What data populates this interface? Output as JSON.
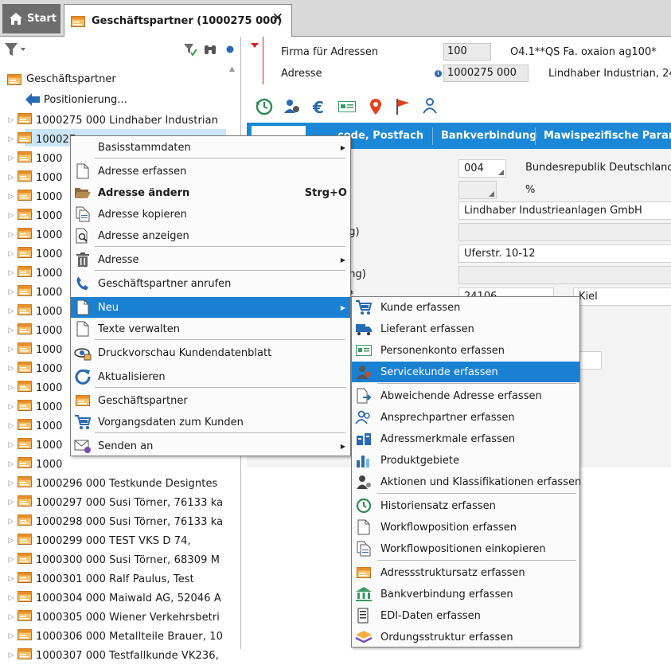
{
  "tabs": {
    "start_label": "Start",
    "active_label": "Geschäftspartner (1000275 000)"
  },
  "tree": {
    "root_label": "Geschäftspartner",
    "positioning_label": "Positionierung...",
    "rows": [
      {
        "id": "1000275",
        "sub": "000",
        "text": "Lindhaber Industrian"
      },
      {
        "id": "100027",
        "sub": "",
        "text": ""
      },
      {
        "id": "1000",
        "sub": "",
        "text": ""
      },
      {
        "id": "1000",
        "sub": "",
        "text": ""
      },
      {
        "id": "1000",
        "sub": "",
        "text": ""
      },
      {
        "id": "1000",
        "sub": "",
        "text": ""
      },
      {
        "id": "1000",
        "sub": "",
        "text": ""
      },
      {
        "id": "1000",
        "sub": "",
        "text": ""
      },
      {
        "id": "1000",
        "sub": "",
        "text": ""
      },
      {
        "id": "1000",
        "sub": "",
        "text": ""
      },
      {
        "id": "1000",
        "sub": "",
        "text": ""
      },
      {
        "id": "1000",
        "sub": "",
        "text": ""
      },
      {
        "id": "1000",
        "sub": "",
        "text": ""
      },
      {
        "id": "1000",
        "sub": "",
        "text": ""
      },
      {
        "id": "1000",
        "sub": "",
        "text": ""
      },
      {
        "id": "1000",
        "sub": "",
        "text": ""
      },
      {
        "id": "1000",
        "sub": "",
        "text": ""
      },
      {
        "id": "1000",
        "sub": "",
        "text": ""
      },
      {
        "id": "1000",
        "sub": "",
        "text": ""
      },
      {
        "id": "1000296",
        "sub": "000",
        "text": "Testkunde Designtes"
      },
      {
        "id": "1000297",
        "sub": "000",
        "text": "Susi Törner, 76133 ka"
      },
      {
        "id": "1000298",
        "sub": "000",
        "text": "Susi Törner, 76133 ka"
      },
      {
        "id": "1000299",
        "sub": "000",
        "text": "TEST VKS D 74,"
      },
      {
        "id": "1000300",
        "sub": "000",
        "text": "Susi Törner, 68309 M"
      },
      {
        "id": "1000301",
        "sub": "000",
        "text": "Ralf Paulus, Test"
      },
      {
        "id": "1000304",
        "sub": "000",
        "text": "Maiwald AG, 52046 A"
      },
      {
        "id": "1000305",
        "sub": "000",
        "text": "Wiener Verkehrsbetri"
      },
      {
        "id": "1000306",
        "sub": "000",
        "text": "Metallteile Brauer, 10"
      },
      {
        "id": "1000307",
        "sub": "000",
        "text": "Testfallkunde VK236,"
      }
    ]
  },
  "header": {
    "firma_label": "Firma für Adressen",
    "firma_value": "100",
    "firma_desc": "O4.1**QS Fa. oxaion ag100*",
    "adresse_label": "Adresse",
    "adresse_value": "1000275 000",
    "adresse_desc": "Lindhaber Industrian, 24"
  },
  "detail_tabs": {
    "tab2": "code, Postfach",
    "tab3": "Bankverbindung",
    "tab4": "Mawispezifische Parame"
  },
  "form": {
    "country_code": "004",
    "country_name": "Bundesrepublik Deutschland",
    "percent": "%",
    "name_value": "Lindhaber Industrieanlagen GmbH",
    "label_ng1": "ng)",
    "street_value": "Uferstr. 10-12",
    "label_ng2": "ung)",
    "label_star": "*",
    "zip_value": "24106",
    "city_value": "Kiel"
  },
  "context_menu": {
    "items": [
      {
        "label": "Basisstammdaten",
        "icon": "none",
        "arrow": true
      },
      {
        "label": "Adresse erfassen",
        "icon": "document-icon"
      },
      {
        "label": "Adresse ändern",
        "icon": "folder-open-icon",
        "shortcut": "Strg+O",
        "bold": true
      },
      {
        "label": "Adresse kopieren",
        "icon": "copy-icon"
      },
      {
        "label": "Adresse anzeigen",
        "icon": "magnifier-document-icon"
      },
      {
        "label": "Adresse",
        "icon": "trash-icon",
        "arrow": true
      },
      {
        "label": "Geschäftspartner anrufen",
        "icon": "phone-icon"
      },
      {
        "label": "Neu",
        "icon": "document-icon",
        "arrow": true,
        "highlighted": true
      },
      {
        "label": "Texte verwalten",
        "icon": "document-icon"
      },
      {
        "label": "Druckvorschau Kundendatenblatt",
        "icon": "print-preview-icon"
      },
      {
        "label": "Aktualisieren",
        "icon": "refresh-icon"
      },
      {
        "label": "Geschäftspartner",
        "icon": "business-partner-icon"
      },
      {
        "label": "Vorgangsdaten zum Kunden",
        "icon": "cart-icon"
      },
      {
        "label": "Senden an",
        "icon": "envelope-icon",
        "arrow": true
      }
    ]
  },
  "submenu": {
    "items": [
      {
        "label": "Kunde erfassen",
        "icon": "cart-icon"
      },
      {
        "label": "Lieferant erfassen",
        "icon": "truck-icon"
      },
      {
        "label": "Personenkonto erfassen",
        "icon": "account-card-icon"
      },
      {
        "label": "Servicekunde erfassen",
        "icon": "service-person-icon",
        "highlighted": true
      },
      {
        "label": "Abweichende Adresse erfassen",
        "icon": "document-arrow-icon"
      },
      {
        "label": "Ansprechpartner erfassen",
        "icon": "contacts-icon"
      },
      {
        "label": "Adressmerkmale erfassen",
        "icon": "address-attributes-icon"
      },
      {
        "label": "Produktgebiete",
        "icon": "bar-chart-icon"
      },
      {
        "label": "Aktionen und Klassifikationen erfassen",
        "icon": "person-gear-icon"
      },
      {
        "label": "Historiensatz erfassen",
        "icon": "history-icon"
      },
      {
        "label": "Workflowposition erfassen",
        "icon": "document-icon"
      },
      {
        "label": "Workflowpositionen einkopieren",
        "icon": "copy-icon"
      },
      {
        "label": "Adressstruktursatz erfassen",
        "icon": "business-partner-icon"
      },
      {
        "label": "Bankverbindung erfassen",
        "icon": "bank-icon"
      },
      {
        "label": "EDI-Daten erfassen",
        "icon": "edi-icon"
      },
      {
        "label": "Ordungsstruktur erfassen",
        "icon": "layers-icon"
      }
    ]
  },
  "colors": {
    "accent_blue": "#1a80d2",
    "tab_bar_gray": "#d9d9d9",
    "start_tab": "#6d6d6d",
    "selection": "#cde6f7"
  }
}
